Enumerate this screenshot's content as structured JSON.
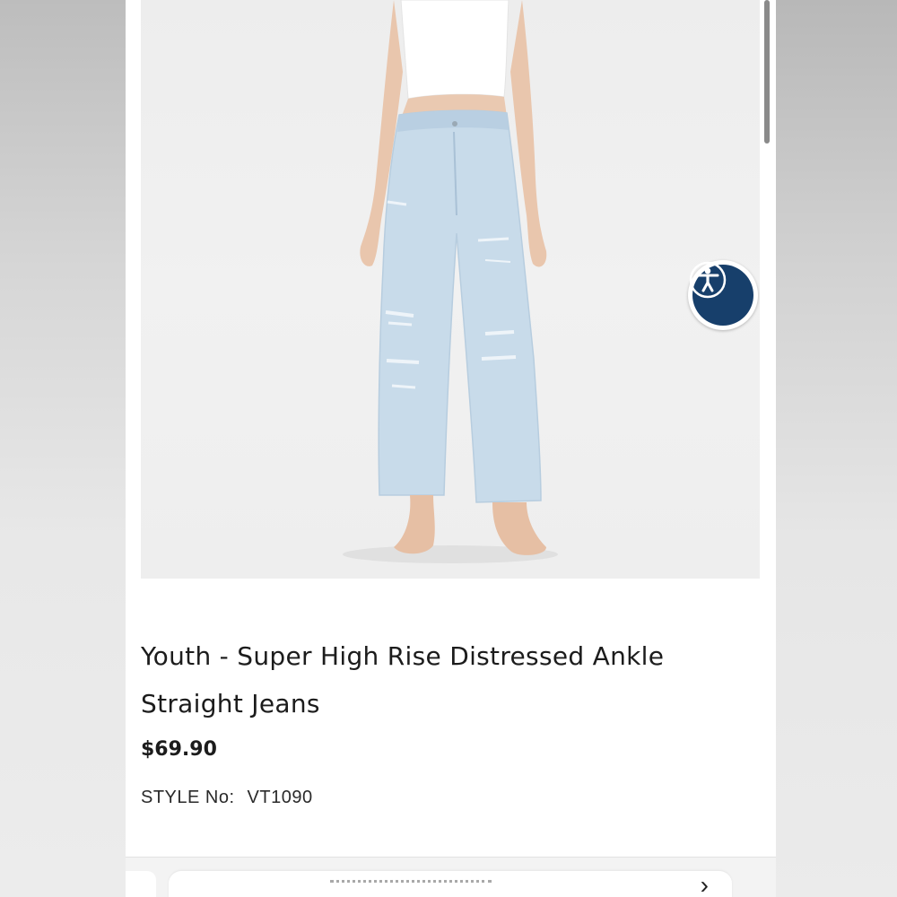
{
  "product": {
    "title": "Youth - Super High Rise Distressed Ankle Straight Jeans",
    "price": "$69.90",
    "style_label": "STYLE No:",
    "style_number": "VT1090"
  },
  "accessibility": {
    "icon": "accessibility-icon",
    "color": "#173f6b"
  },
  "bottom_bar": {
    "icon": "arrow-right-icon"
  }
}
